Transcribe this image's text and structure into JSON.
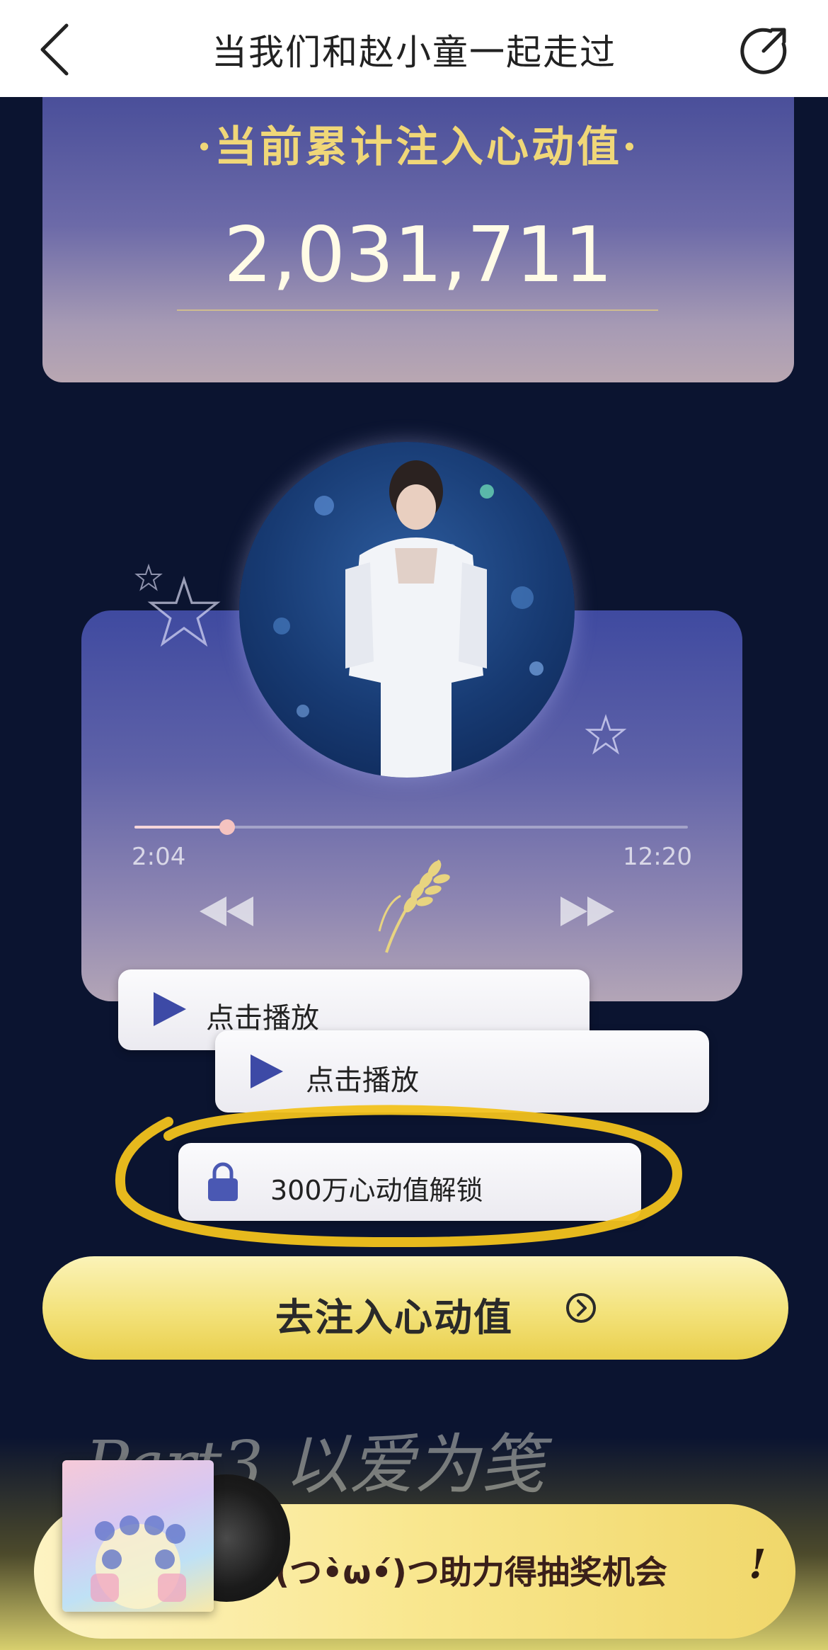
{
  "header": {
    "title": "当我们和赵小童一起走过"
  },
  "stats": {
    "label": "·当前累计注入心动值·",
    "value": "2,031,711"
  },
  "player": {
    "current_time": "2:04",
    "total_time": "12:20",
    "progress": 0.168
  },
  "play_items": [
    {
      "label": "点击播放"
    },
    {
      "label": "点击播放"
    }
  ],
  "locked_item": {
    "label": "300万心动值解锁"
  },
  "cta": {
    "label": "去注入心动值"
  },
  "banner": {
    "handwriting": "Part3 以爱为笺",
    "label": "(つ•̀ω•́)つ助力得抽奖机会",
    "exclaim": "!"
  },
  "colors": {
    "gold": "#f0d778",
    "cta_yellow": "#f3e27a",
    "bg": "#0b1430"
  }
}
